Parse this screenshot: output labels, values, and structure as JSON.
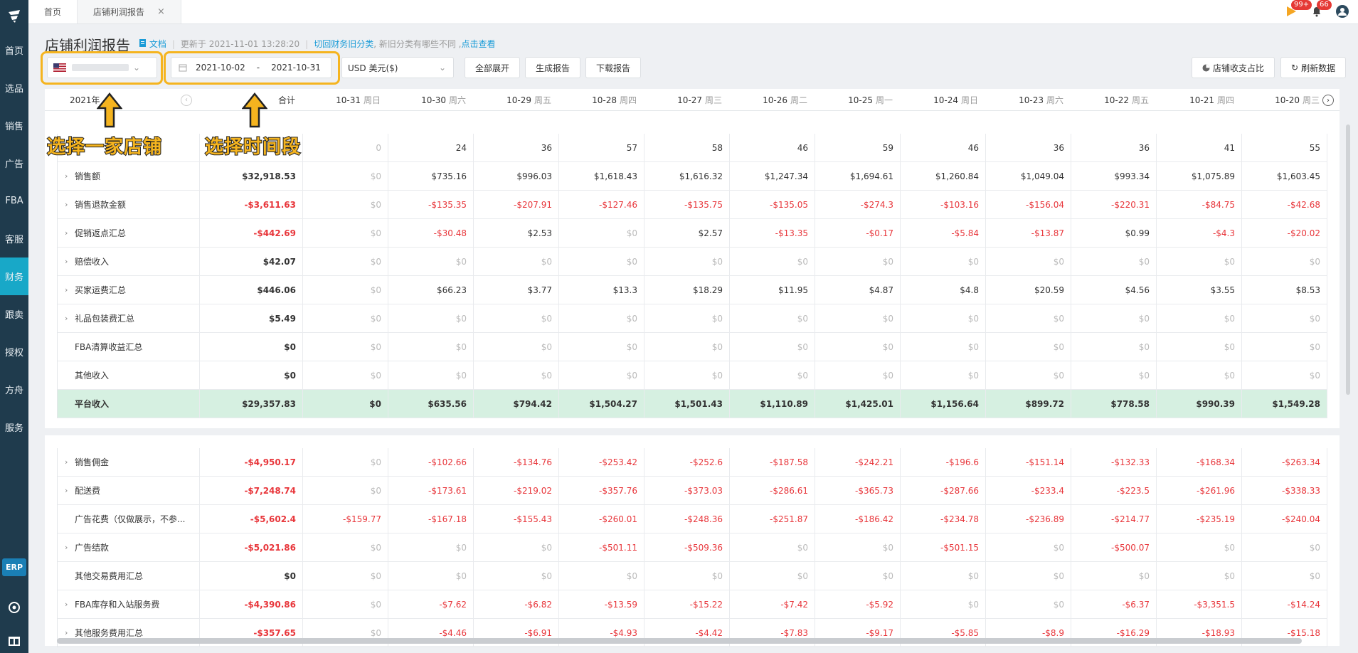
{
  "sidebar": {
    "items": [
      "首页",
      "选品",
      "销售",
      "广告",
      "FBA",
      "客服",
      "财务",
      "跟卖",
      "授权",
      "方舟",
      "服务"
    ],
    "active_index": 6,
    "erp_label": "ERP"
  },
  "tabs": [
    {
      "label": "首页"
    },
    {
      "label": "店铺利润报告"
    }
  ],
  "notifications": {
    "messages_badge": "99+",
    "alerts_badge": "66"
  },
  "header": {
    "title": "店铺利润报告",
    "doc_link": "文档",
    "updated": "更新于 2021-11-01 13:28:20",
    "switch_link": "切回财务旧分类",
    "note": ", 新旧分类有哪些不同 ,",
    "view_link": "点击查看"
  },
  "toolbar": {
    "store_value": "",
    "date_start": "2021-10-02",
    "date_sep": "-",
    "date_end": "2021-10-31",
    "currency": "USD  美元($)",
    "expand_all": "全部展开",
    "generate": "生成报告",
    "download": "下载报告",
    "ratio": "店铺收支占比",
    "refresh": "刷新数据"
  },
  "annotations": {
    "store_hint": "选择一家店铺",
    "date_hint": "选择时间段"
  },
  "columns": {
    "year": "2021年",
    "total": "合计",
    "dates": [
      {
        "date": "10-31",
        "weekday": "周日"
      },
      {
        "date": "10-30",
        "weekday": "周六"
      },
      {
        "date": "10-29",
        "weekday": "周五"
      },
      {
        "date": "10-28",
        "weekday": "周四"
      },
      {
        "date": "10-27",
        "weekday": "周三"
      },
      {
        "date": "10-26",
        "weekday": "周二"
      },
      {
        "date": "10-25",
        "weekday": "周一"
      },
      {
        "date": "10-24",
        "weekday": "周日"
      },
      {
        "date": "10-23",
        "weekday": "周六"
      },
      {
        "date": "10-22",
        "weekday": "周五"
      },
      {
        "date": "10-21",
        "weekday": "周四"
      },
      {
        "date": "10-20",
        "weekday": "周三"
      }
    ]
  },
  "table1": [
    {
      "label": "",
      "expand": false,
      "total": "",
      "values": [
        "0",
        "24",
        "36",
        "57",
        "58",
        "46",
        "59",
        "46",
        "36",
        "36",
        "41",
        "55"
      ]
    },
    {
      "label": "销售额",
      "expand": true,
      "total": "$32,918.53",
      "values": [
        "$0",
        "$735.16",
        "$996.03",
        "$1,618.43",
        "$1,616.32",
        "$1,247.34",
        "$1,694.61",
        "$1,260.84",
        "$1,049.04",
        "$993.34",
        "$1,075.89",
        "$1,603.45"
      ]
    },
    {
      "label": "销售退款金额",
      "expand": true,
      "total": "-$3,611.63",
      "values": [
        "$0",
        "-$135.35",
        "-$207.91",
        "-$127.46",
        "-$135.75",
        "-$135.05",
        "-$274.3",
        "-$103.16",
        "-$156.04",
        "-$220.31",
        "-$84.75",
        "-$42.68"
      ]
    },
    {
      "label": "促销返点汇总",
      "expand": true,
      "total": "-$442.69",
      "values": [
        "$0",
        "-$30.48",
        "$2.53",
        "$0",
        "$2.57",
        "-$13.35",
        "-$0.17",
        "-$5.84",
        "-$13.87",
        "$0.99",
        "-$4.3",
        "-$20.02"
      ]
    },
    {
      "label": "赔偿收入",
      "expand": true,
      "total": "$42.07",
      "values": [
        "$0",
        "$0",
        "$0",
        "$0",
        "$0",
        "$0",
        "$0",
        "$0",
        "$0",
        "$0",
        "$0",
        "$0"
      ]
    },
    {
      "label": "买家运费汇总",
      "expand": true,
      "total": "$446.06",
      "values": [
        "$0",
        "$66.23",
        "$3.77",
        "$13.3",
        "$18.29",
        "$11.95",
        "$4.87",
        "$4.8",
        "$20.59",
        "$4.56",
        "$3.55",
        "$8.53"
      ]
    },
    {
      "label": "礼品包装费汇总",
      "expand": true,
      "total": "$5.49",
      "values": [
        "$0",
        "$0",
        "$0",
        "$0",
        "$0",
        "$0",
        "$0",
        "$0",
        "$0",
        "$0",
        "$0",
        "$0"
      ]
    },
    {
      "label": "FBA清算收益汇总",
      "expand": false,
      "total": "$0",
      "values": [
        "$0",
        "$0",
        "$0",
        "$0",
        "$0",
        "$0",
        "$0",
        "$0",
        "$0",
        "$0",
        "$0",
        "$0"
      ]
    },
    {
      "label": "其他收入",
      "expand": false,
      "total": "$0",
      "values": [
        "$0",
        "$0",
        "$0",
        "$0",
        "$0",
        "$0",
        "$0",
        "$0",
        "$0",
        "$0",
        "$0",
        "$0"
      ]
    },
    {
      "label": "平台收入",
      "expand": false,
      "total": "$29,357.83",
      "is_total": true,
      "values": [
        "$0",
        "$635.56",
        "$794.42",
        "$1,504.27",
        "$1,501.43",
        "$1,110.89",
        "$1,425.01",
        "$1,156.64",
        "$899.72",
        "$778.58",
        "$990.39",
        "$1,549.28"
      ]
    }
  ],
  "table2": [
    {
      "label": "销售佣金",
      "expand": true,
      "total": "-$4,950.17",
      "values": [
        "$0",
        "-$102.66",
        "-$134.76",
        "-$253.42",
        "-$252.6",
        "-$187.58",
        "-$242.21",
        "-$196.6",
        "-$151.14",
        "-$132.33",
        "-$168.34",
        "-$263.34"
      ]
    },
    {
      "label": "配送费",
      "expand": true,
      "total": "-$7,248.74",
      "values": [
        "$0",
        "-$173.61",
        "-$219.02",
        "-$357.76",
        "-$373.03",
        "-$286.61",
        "-$365.73",
        "-$287.66",
        "-$233.4",
        "-$223.5",
        "-$261.96",
        "-$338.33"
      ]
    },
    {
      "label": "广告花费（仅做展示，不参...",
      "expand": false,
      "total": "-$5,602.4",
      "values": [
        "-$159.77",
        "-$167.18",
        "-$155.43",
        "-$260.01",
        "-$248.36",
        "-$251.87",
        "-$186.42",
        "-$234.78",
        "-$236.89",
        "-$214.77",
        "-$235.19",
        "-$240.04"
      ]
    },
    {
      "label": "广告结款",
      "expand": true,
      "total": "-$5,021.86",
      "values": [
        "$0",
        "$0",
        "$0",
        "-$501.11",
        "-$509.36",
        "$0",
        "$0",
        "-$501.15",
        "$0",
        "-$500.07",
        "$0",
        "$0"
      ]
    },
    {
      "label": "其他交易费用汇总",
      "expand": false,
      "total": "$0",
      "values": [
        "$0",
        "$0",
        "$0",
        "$0",
        "$0",
        "$0",
        "$0",
        "$0",
        "$0",
        "$0",
        "$0",
        "$0"
      ]
    },
    {
      "label": "FBA库存和入站服务费",
      "expand": true,
      "total": "-$4,390.86",
      "values": [
        "$0",
        "-$7.62",
        "-$6.82",
        "-$13.59",
        "-$15.22",
        "-$7.42",
        "-$5.92",
        "$0",
        "$0",
        "-$6.37",
        "-$3,351.5",
        "-$14.24"
      ]
    },
    {
      "label": "其他服务费用汇总",
      "expand": true,
      "total": "-$357.65",
      "values": [
        "$0",
        "-$4.46",
        "-$6.91",
        "-$4.93",
        "-$4.42",
        "-$7.83",
        "-$9.17",
        "-$5.85",
        "-$8.9",
        "-$16.29",
        "-$18.93",
        "-$15.18"
      ]
    }
  ],
  "colors": {
    "accent": "#18a8c8",
    "negative": "#e8363b",
    "highlight": "#f5b41f",
    "total_row": "#d6f0e1"
  }
}
